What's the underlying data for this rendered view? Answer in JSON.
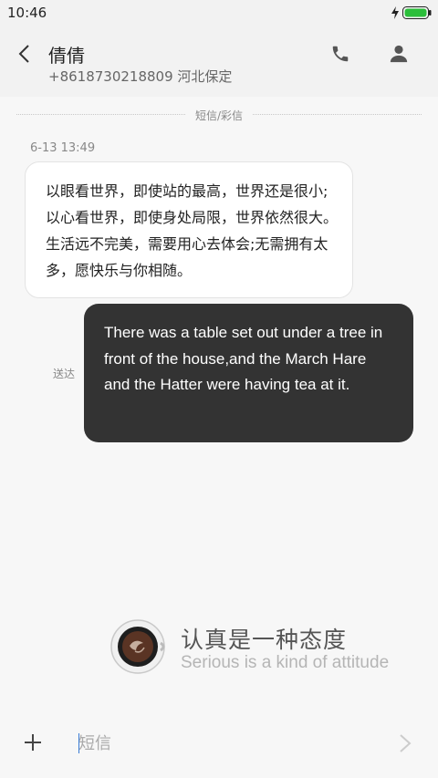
{
  "status_bar": {
    "time": "10:46",
    "icons": [
      "charging-bolt-icon",
      "battery-icon"
    ],
    "battery_color": "#2bbf3a"
  },
  "header": {
    "contact_name": "倩倩",
    "contact_subtitle": "+8618730218809 河北保定",
    "icons": [
      "back-arrow-icon",
      "phone-icon",
      "person-icon"
    ]
  },
  "conversation": {
    "divider_label": "短信/彩信",
    "timestamp": "6-13 13:49",
    "incoming_message": "以眼看世界，即使站的最高，世界还是很小;以心看世界，即使身处局限，世界依然很大。生活远不完美，需要用心去体会;无需拥有太多，愿快乐与你相随。",
    "outgoing_message": "There was a table set out under a tree in front of the house,and the March Hare and the Hatter were having tea at it.",
    "outgoing_status": "送达"
  },
  "brand": {
    "title": "认真是一种态度",
    "subtitle": "Serious is a kind of attitude",
    "icon": "coffee-cup-icon"
  },
  "compose": {
    "placeholder": "短信",
    "value": "",
    "icons": [
      "add-icon",
      "send-chevron-icon"
    ]
  },
  "colors": {
    "outgoing_bubble": "#333333",
    "incoming_bubble": "#ffffff",
    "cursor": "#3a7bd5"
  }
}
